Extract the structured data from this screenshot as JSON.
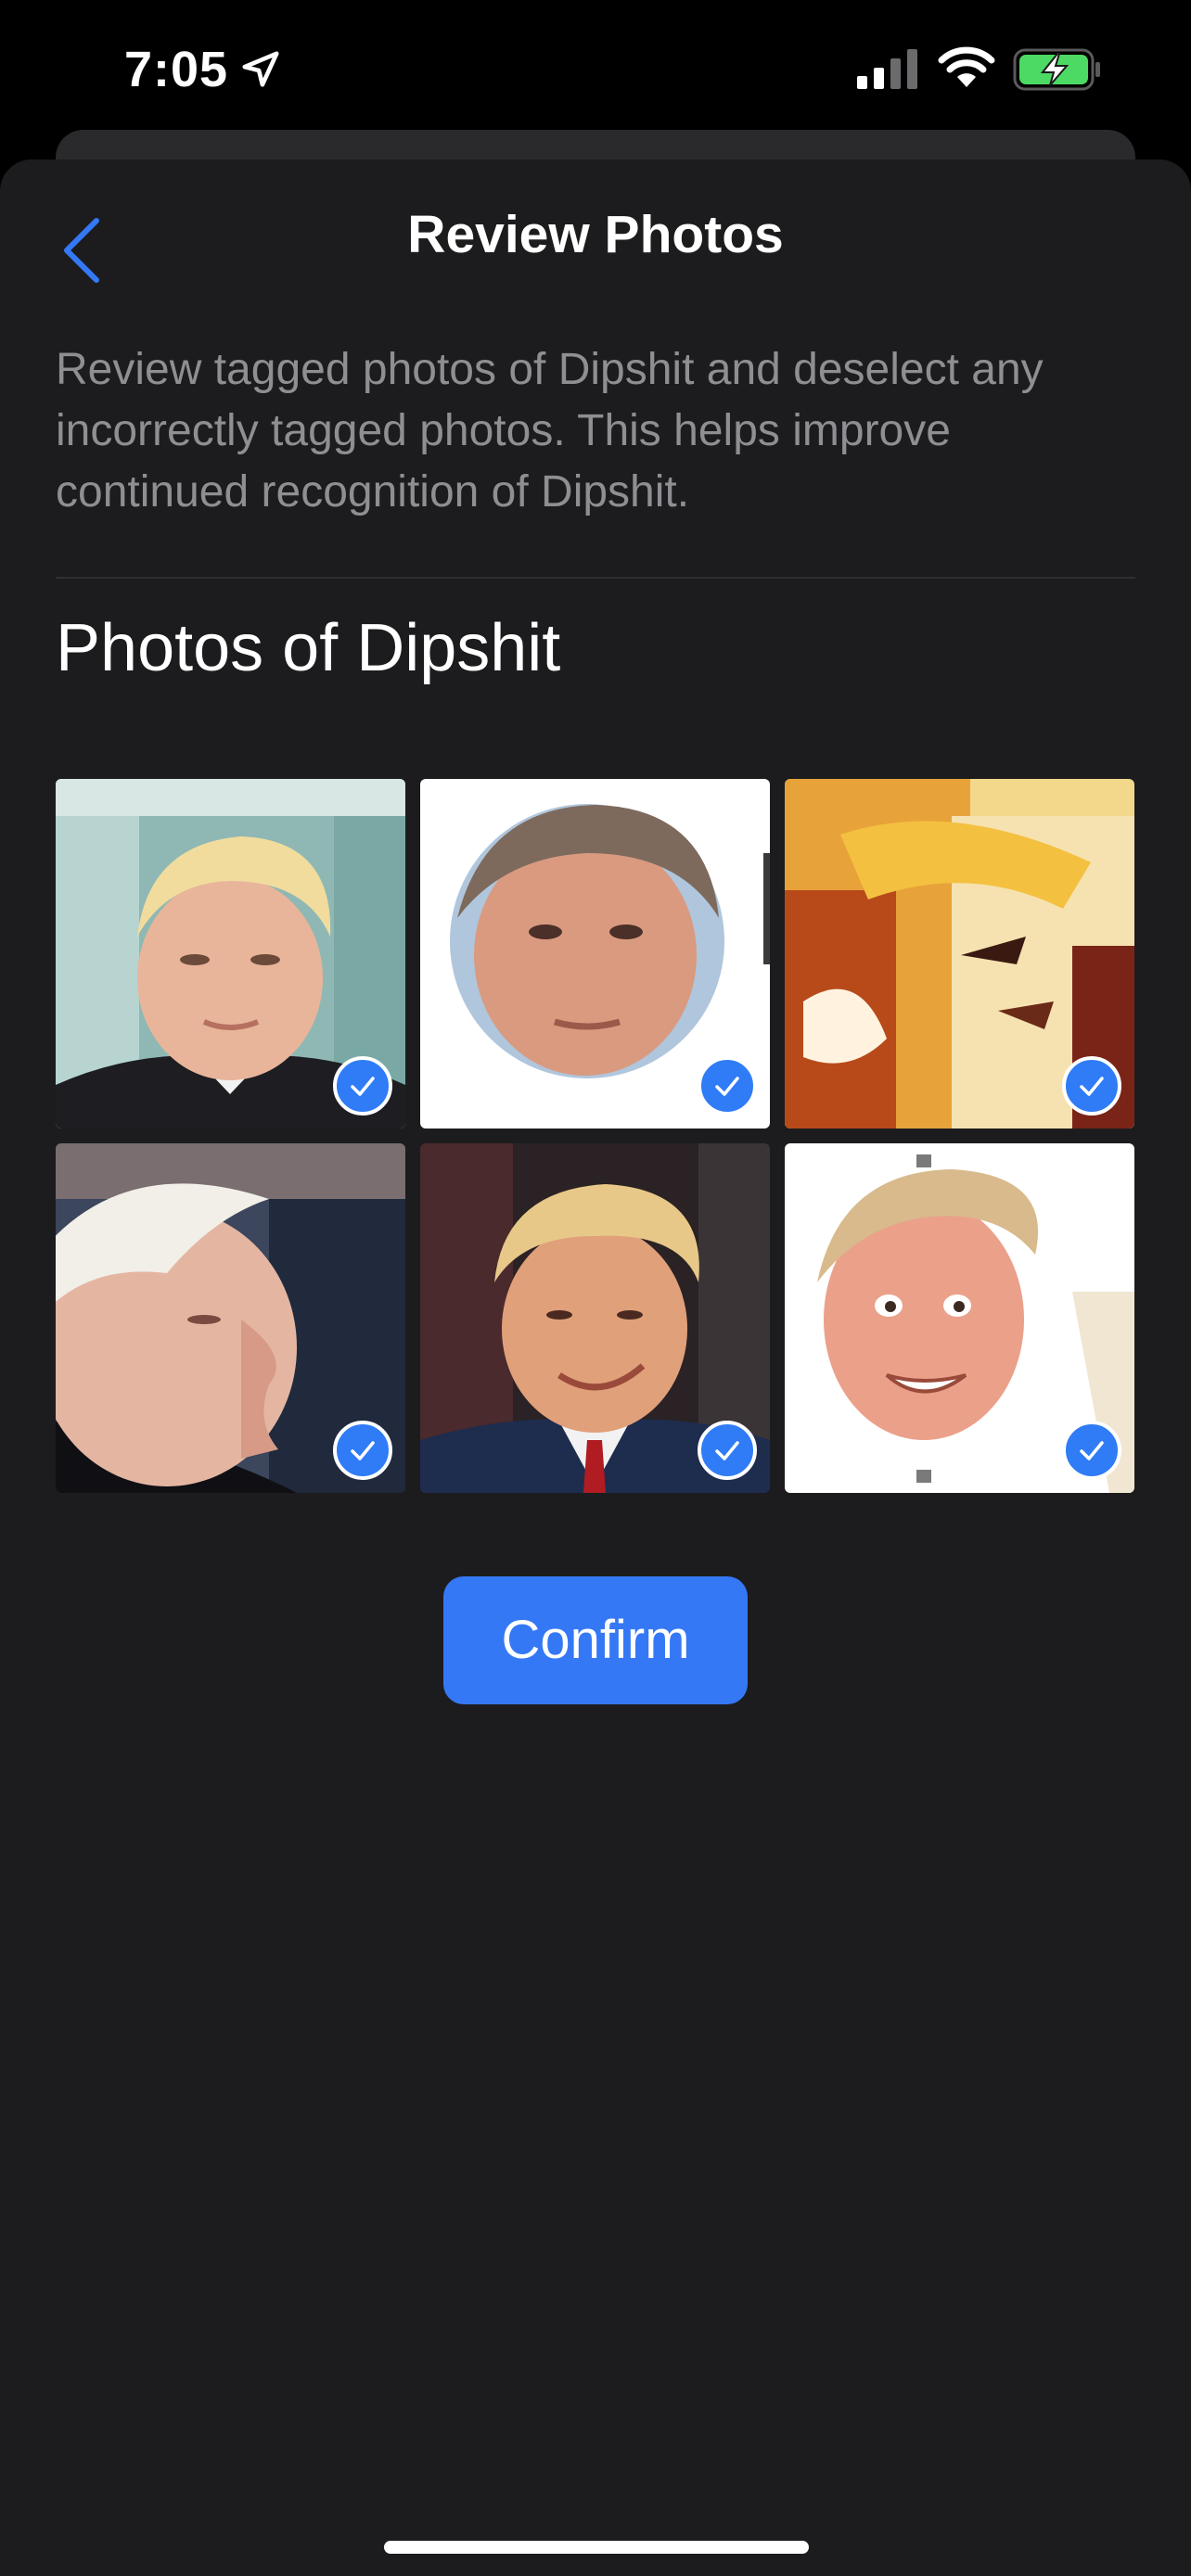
{
  "status_bar": {
    "time": "7:05",
    "icons": [
      "location-arrow-icon",
      "cellular-signal-icon",
      "wifi-icon",
      "battery-charging-icon"
    ]
  },
  "header": {
    "title": "Review Photos",
    "back_icon": "chevron-left-icon"
  },
  "description": "Review tagged photos of Dipshit and deselect any incorrectly tagged photos. This helps improve continued recognition of Dipshit.",
  "section_title": "Photos of Dipshit",
  "photos": [
    {
      "selected": true,
      "icon": "checkmark-icon"
    },
    {
      "selected": true,
      "icon": "checkmark-icon"
    },
    {
      "selected": true,
      "icon": "checkmark-icon"
    },
    {
      "selected": true,
      "icon": "checkmark-icon"
    },
    {
      "selected": true,
      "icon": "checkmark-icon"
    },
    {
      "selected": true,
      "icon": "checkmark-icon"
    }
  ],
  "confirm_label": "Confirm",
  "colors": {
    "accent": "#3478f6",
    "sheet_background": "#1c1c1e",
    "secondary_text": "#8e8e93"
  }
}
